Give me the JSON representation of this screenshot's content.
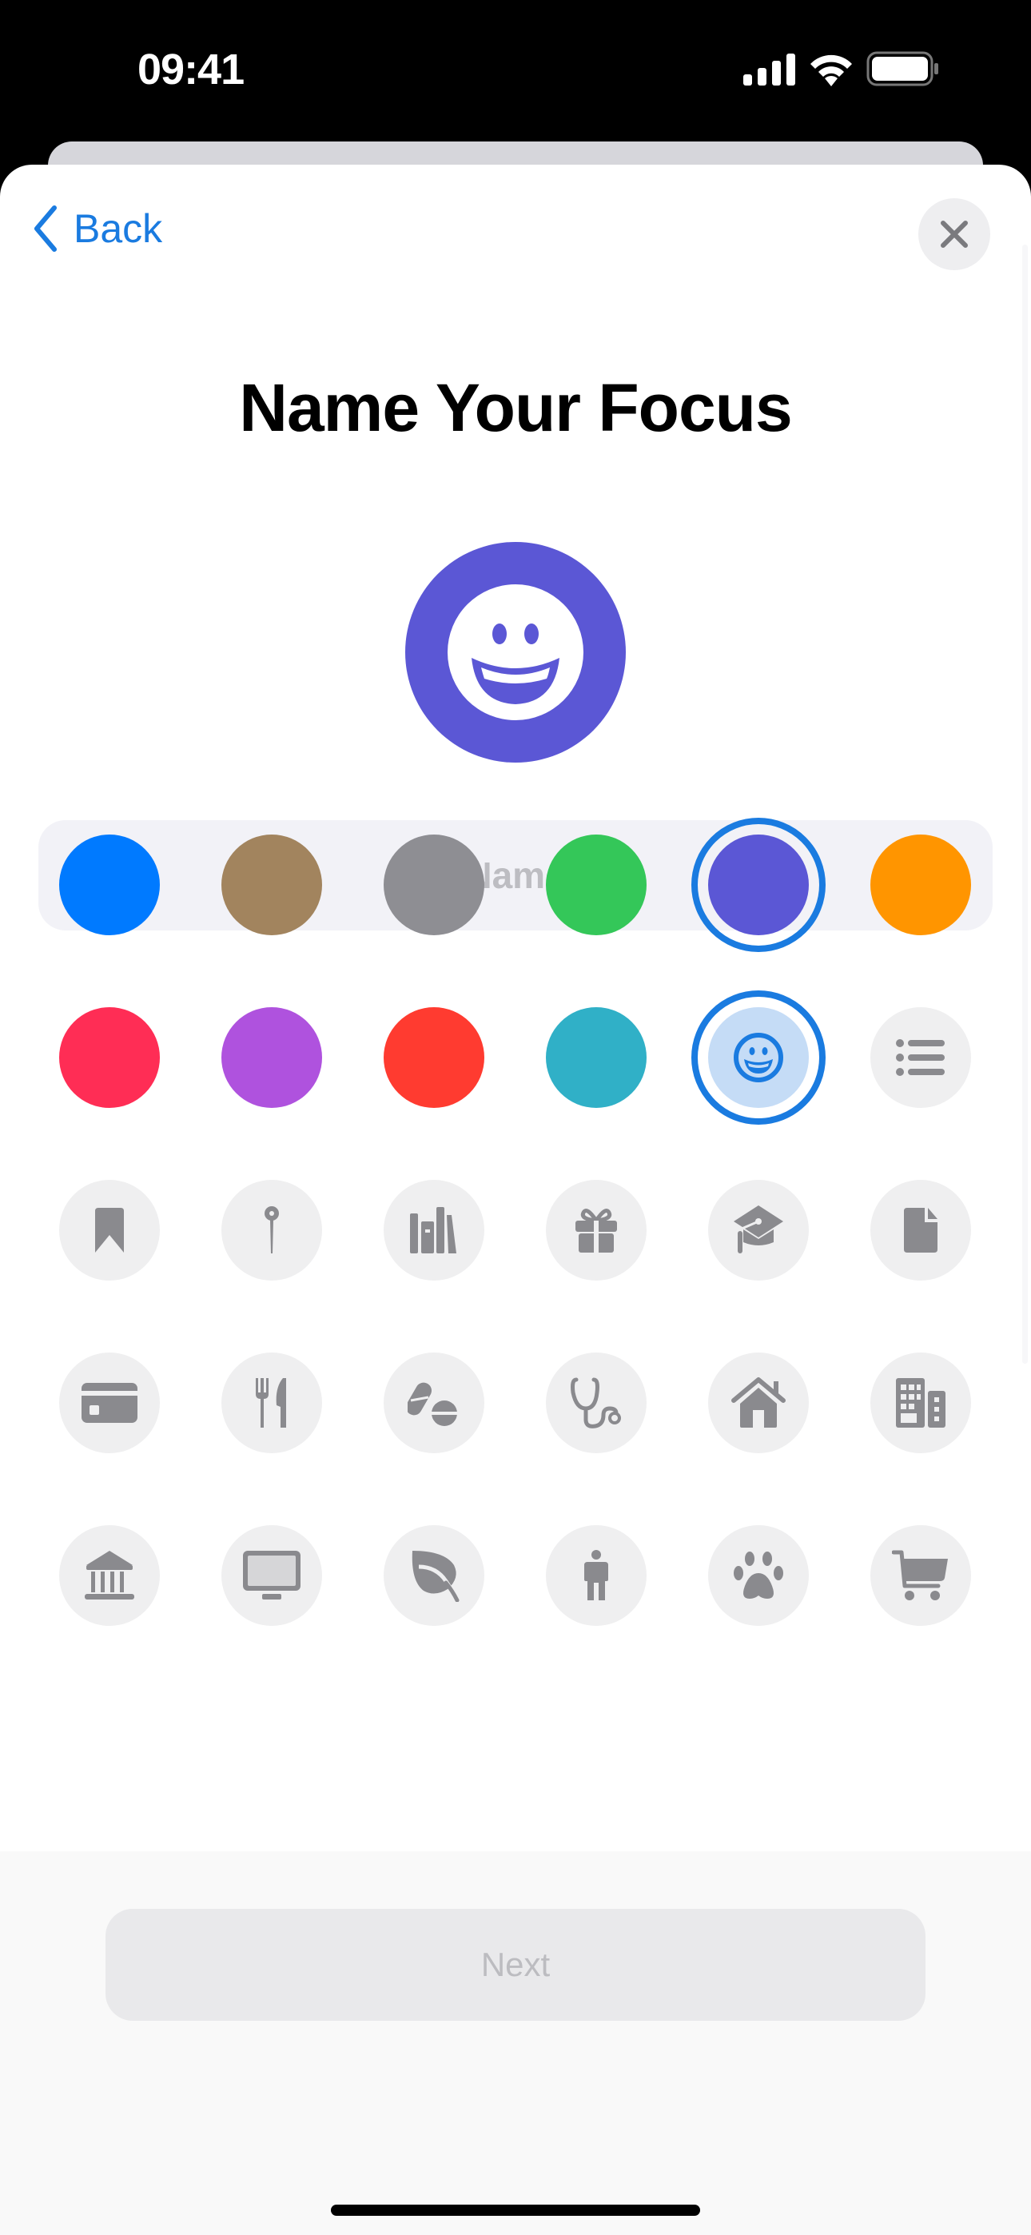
{
  "status_bar": {
    "time": "09:41"
  },
  "nav": {
    "back_label": "Back"
  },
  "page": {
    "title": "Name Your Focus"
  },
  "hero": {
    "icon": "smiley-face-icon",
    "color": "#5b57d5"
  },
  "name_input": {
    "value": "",
    "placeholder": "Name"
  },
  "colors": [
    {
      "name": "blue",
      "hex": "#007aff",
      "selected": false
    },
    {
      "name": "brown",
      "hex": "#a2845e",
      "selected": false
    },
    {
      "name": "gray",
      "hex": "#8e8e93",
      "selected": false
    },
    {
      "name": "green",
      "hex": "#34c759",
      "selected": false
    },
    {
      "name": "indigo",
      "hex": "#5b57d5",
      "selected": true
    },
    {
      "name": "orange",
      "hex": "#ff9500",
      "selected": false
    },
    {
      "name": "pink",
      "hex": "#ff2d55",
      "selected": false
    },
    {
      "name": "purple",
      "hex": "#af52de",
      "selected": false
    },
    {
      "name": "red",
      "hex": "#ff3b30",
      "selected": false
    },
    {
      "name": "teal",
      "hex": "#30b0c7",
      "selected": false
    }
  ],
  "symbols": [
    {
      "name": "smiley-face-icon",
      "selected": true
    },
    {
      "name": "list-bullet-icon",
      "selected": false
    },
    {
      "name": "bookmark-icon",
      "selected": false
    },
    {
      "name": "pin-icon",
      "selected": false
    },
    {
      "name": "books-icon",
      "selected": false
    },
    {
      "name": "gift-icon",
      "selected": false
    },
    {
      "name": "graduation-cap-icon",
      "selected": false
    },
    {
      "name": "document-icon",
      "selected": false
    },
    {
      "name": "credit-card-icon",
      "selected": false
    },
    {
      "name": "fork-knife-icon",
      "selected": false
    },
    {
      "name": "pills-icon",
      "selected": false
    },
    {
      "name": "stethoscope-icon",
      "selected": false
    },
    {
      "name": "house-icon",
      "selected": false
    },
    {
      "name": "building-icon",
      "selected": false
    },
    {
      "name": "bank-icon",
      "selected": false
    },
    {
      "name": "desktop-computer-icon",
      "selected": false
    },
    {
      "name": "leaf-icon",
      "selected": false
    },
    {
      "name": "person-icon",
      "selected": false
    },
    {
      "name": "paw-print-icon",
      "selected": false
    },
    {
      "name": "shopping-cart-icon",
      "selected": false
    }
  ],
  "accent_color": "#1a7be0",
  "footer": {
    "next_label": "Next"
  }
}
